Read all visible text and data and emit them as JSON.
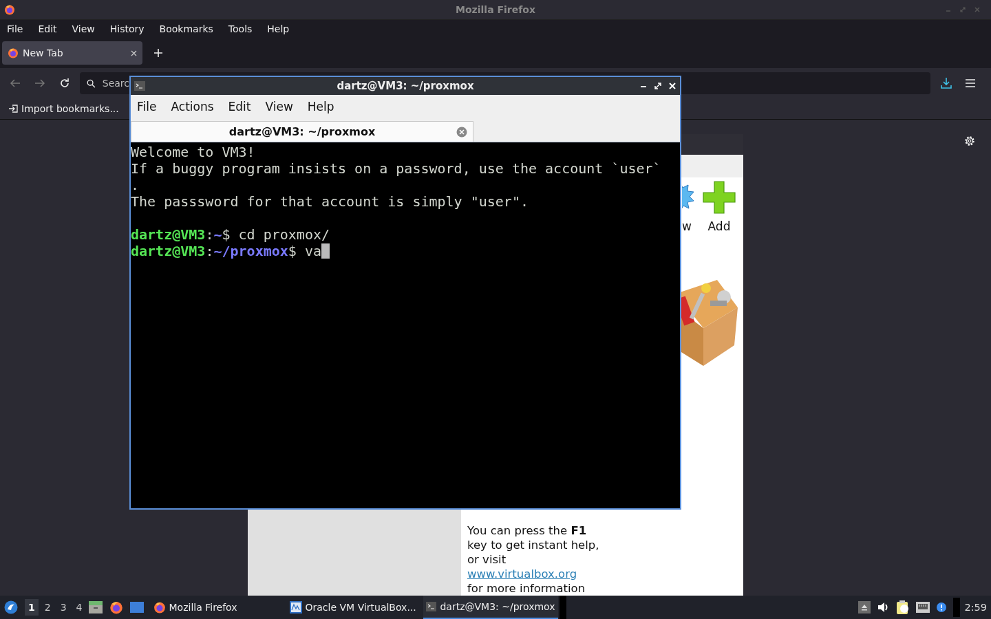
{
  "firefox": {
    "title": "Mozilla Firefox",
    "menu": [
      "File",
      "Edit",
      "View",
      "History",
      "Bookmarks",
      "Tools",
      "Help"
    ],
    "tabs": [
      {
        "label": "New Tab",
        "selected": true
      }
    ],
    "search": {
      "placeholder": "Searc"
    },
    "bookmarks": [
      "Import bookmarks..."
    ]
  },
  "virtualbox": {
    "toolbar": [
      {
        "kind": "new",
        "label": "w"
      },
      {
        "kind": "add",
        "label": "Add"
      }
    ],
    "help_lines": [
      "You can press the **F1**",
      "key to get instant help,",
      "or visit"
    ],
    "link": "www.virtualbox.org",
    "help_after": "for more information"
  },
  "terminal": {
    "title": "dartz@VM3: ~/proxmox",
    "menu": [
      "File",
      "Actions",
      "Edit",
      "View",
      "Help"
    ],
    "tabs": [
      {
        "label": "dartz@VM3: ~/proxmox",
        "selected": true
      }
    ],
    "lines": [
      {
        "kind": "output",
        "segments": [
          {
            "kind": "text",
            "text": "Welcome to VM3!"
          }
        ]
      },
      {
        "kind": "output",
        "segments": [
          {
            "kind": "text",
            "text": "If a buggy program insists on a password, use the account `user`"
          }
        ]
      },
      {
        "kind": "output",
        "segments": [
          {
            "kind": "text",
            "text": "."
          }
        ]
      },
      {
        "kind": "output",
        "segments": [
          {
            "kind": "text",
            "text": "The passsword for that account is simply \"user\"."
          }
        ]
      },
      {
        "kind": "blank"
      },
      {
        "kind": "output",
        "segments": [
          {
            "kind": "user",
            "text": "dartz@VM3"
          },
          {
            "kind": "text",
            "text": ":"
          },
          {
            "kind": "path",
            "text": "~"
          },
          {
            "kind": "text",
            "text": "$ cd proxmox/"
          }
        ]
      },
      {
        "kind": "output",
        "segments": [
          {
            "kind": "user",
            "text": "dartz@VM3"
          },
          {
            "kind": "text",
            "text": ":"
          },
          {
            "kind": "path",
            "text": "~/proxmox"
          },
          {
            "kind": "text",
            "text": "$ va"
          }
        ]
      }
    ],
    "cursor": true
  },
  "taskbar": {
    "workspaces": [
      {
        "label": "1",
        "selected": true
      },
      {
        "label": "2",
        "selected": false
      },
      {
        "label": "3",
        "selected": false
      },
      {
        "label": "4",
        "selected": false
      }
    ],
    "tasks": [
      {
        "kind": "firefox",
        "label": "Mozilla Firefox",
        "selected": false
      },
      {
        "kind": "virtualbox",
        "label": "Oracle VM VirtualBox...",
        "selected": false
      },
      {
        "kind": "terminal",
        "label": "dartz@VM3: ~/proxmox",
        "selected": true
      }
    ],
    "clock": "2:59"
  }
}
